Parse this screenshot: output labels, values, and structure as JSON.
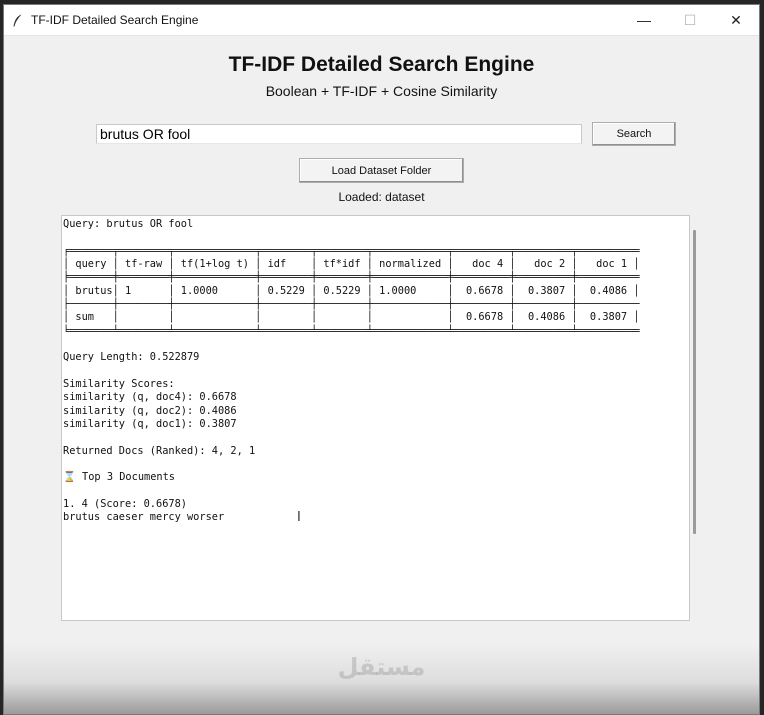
{
  "window": {
    "title": "TF-IDF Detailed Search Engine",
    "controls": {
      "minimize": "—",
      "maximize": "☐",
      "close": "✕"
    }
  },
  "app": {
    "heading": "TF-IDF Detailed Search Engine",
    "subheading": "Boolean + TF-IDF + Cosine Similarity"
  },
  "search": {
    "query_value": "brutus OR fool",
    "button_label": "Search"
  },
  "dataset": {
    "load_button_label": "Load Dataset Folder",
    "status": "Loaded: dataset"
  },
  "output": {
    "lines": [
      "Query: brutus OR fool",
      "",
      "╒═══════╤════════╤═════════════╤════════╤════════╤════════════╤═════════╤═════════╤══════════",
      "│ query │ tf-raw │ tf(1+log t) │ idf    │ tf*idf │ normalized │   doc 4 │   doc 2 │   doc 1 │",
      "╞═══════╪════════╪═════════════╪════════╪════════╪════════════╪═════════╪═════════╪══════════",
      "│ brutus│ 1      │ 1.0000      │ 0.5229 │ 0.5229 │ 1.0000     │  0.6678 │  0.3807 │  0.4086 │",
      "├───────┼────────┼─────────────┼────────┼────────┼────────────┼─────────┼─────────┼──────────",
      "│ sum   │        │             │        │        │            │  0.6678 │  0.4086 │  0.3807 │",
      "╘═══════╧════════╧═════════════╧════════╧════════╧════════════╧═════════╧═════════╧══════════",
      "",
      "Query Length: 0.522879",
      "",
      "Similarity Scores:",
      "similarity (q, doc4): 0.6678",
      "similarity (q, doc2): 0.4086",
      "similarity (q, doc1): 0.3807",
      "",
      "Returned Docs (Ranked): 4, 2, 1",
      "",
      "⌛ Top 3 Documents",
      "",
      "1. 4 (Score: 0.6678)",
      "brutus caeser mercy worser"
    ]
  },
  "watermark": {
    "text": "مستقل"
  },
  "colors": {
    "window_bg": "#f0f0f0",
    "titlebar_bg": "#ffffff",
    "output_bg": "#ffffff",
    "text": "#111111"
  }
}
